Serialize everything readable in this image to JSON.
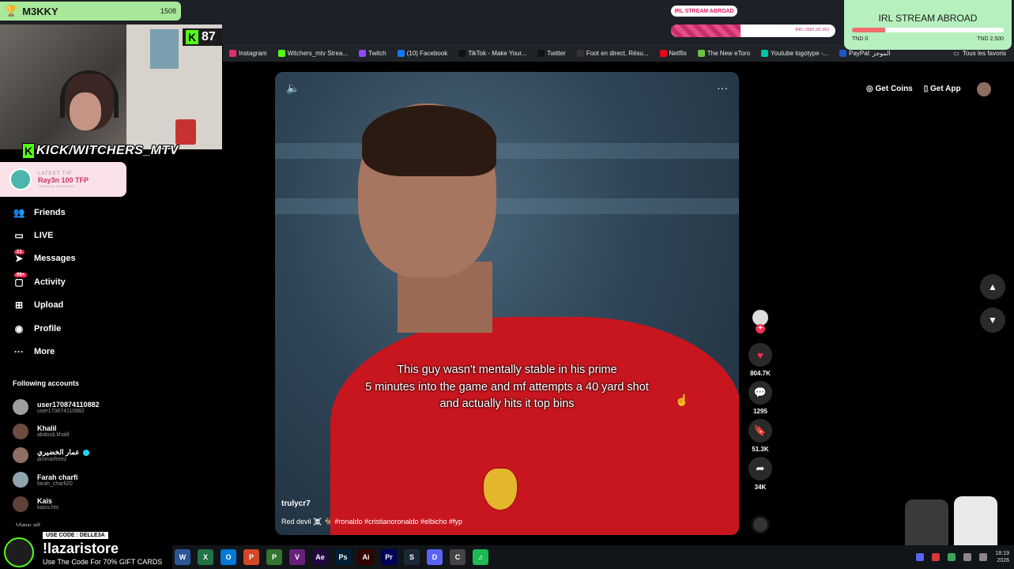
{
  "overlay": {
    "leaderboard": {
      "name": "M3KKY",
      "score": "1508"
    },
    "kick_viewers": {
      "badge": "K",
      "count": "87"
    },
    "kick_banner": {
      "badge": "K",
      "text": "KICK/WITCHERS_MTV"
    },
    "latest_tip": {
      "label": "LATEST TIP",
      "text": "Ray3n 100 TFP",
      "powered": "Powered by Tipeeestream"
    },
    "stream_pill": "IRL STREAM ABROAD",
    "progress": {
      "text": "846 / 2000 (42.3%)",
      "fraction": 0.423
    },
    "goal": {
      "title": "IRL STREAM ABROAD",
      "low": "TND 0",
      "high": "TND 2,500",
      "fraction": 0.22
    },
    "promo": {
      "code": "USE CODE : DELLE3A",
      "title": "!lazaristore",
      "subtitle": "Use The Code For 70% GIFT CARDS"
    }
  },
  "bookmarks": [
    {
      "label": "Instagram",
      "color": "#e1306c"
    },
    {
      "label": "Witchers_mtv Strea...",
      "color": "#53fc18"
    },
    {
      "label": "Twitch",
      "color": "#9146ff"
    },
    {
      "label": "(10) Facebook",
      "color": "#1877f2"
    },
    {
      "label": "TikTok - Make Your...",
      "color": "#111111"
    },
    {
      "label": "Twitter",
      "color": "#111111"
    },
    {
      "label": "Foot en direct, Résu...",
      "color": "#333333"
    },
    {
      "label": "Netflix",
      "color": "#e50914"
    },
    {
      "label": "The New eToro",
      "color": "#69c53e"
    },
    {
      "label": "Youtube logotype -...",
      "color": "#00c4a7"
    },
    {
      "label": "PayPal: الموجز",
      "color": "#1a56c4"
    }
  ],
  "bookmarks_all": "Tous les favoris",
  "nav": [
    {
      "label": "Friends",
      "icon": "👥",
      "badge": ""
    },
    {
      "label": "LIVE",
      "icon": "▭",
      "badge": ""
    },
    {
      "label": "Messages",
      "icon": "➤",
      "badge": "21"
    },
    {
      "label": "Activity",
      "icon": "▢",
      "badge": "99+"
    },
    {
      "label": "Upload",
      "icon": "⊞",
      "badge": ""
    },
    {
      "label": "Profile",
      "icon": "◉",
      "badge": ""
    },
    {
      "label": "More",
      "icon": "···",
      "badge": ""
    }
  ],
  "following_title": "Following accounts",
  "following": [
    {
      "name": "user170874110882",
      "handle": "user170874110882",
      "verified": false
    },
    {
      "name": "Khalil",
      "handle": "abdouli.khalil",
      "verified": false
    },
    {
      "name": "عمار الخضيري",
      "handle": "ammarfreez",
      "verified": true
    },
    {
      "name": "Farah charfi",
      "handle": "farah_charfi20",
      "verified": false
    },
    {
      "name": "Kaïs",
      "handle": "kaiss.hts",
      "verified": false
    }
  ],
  "view_all": "View all",
  "header": {
    "get_coins": "Get Coins",
    "get_app": "Get App"
  },
  "video": {
    "caption_lines": [
      "This guy wasn't mentally stable in his prime",
      "5 minutes into the game and mf attempts a 40 yard shot",
      "and actually hits it top bins"
    ],
    "author": "trulycr7",
    "description": "Red devil ☠️ 🐐 #ronaldo #cristianoronaldo #elbicho #fyp"
  },
  "actions": {
    "likes": "804.7K",
    "comments": "1295",
    "saves": "51.3K",
    "shares": "34K"
  },
  "taskbar": {
    "apps": [
      {
        "label": "W",
        "color": "#2b579a"
      },
      {
        "label": "X",
        "color": "#217346"
      },
      {
        "label": "O",
        "color": "#0078d4"
      },
      {
        "label": "P",
        "color": "#d24726"
      },
      {
        "label": "P",
        "color": "#31752f"
      },
      {
        "label": "V",
        "color": "#68217a"
      },
      {
        "label": "Ae",
        "color": "#1f0740"
      },
      {
        "label": "Ps",
        "color": "#001e36"
      },
      {
        "label": "Ai",
        "color": "#330000"
      },
      {
        "label": "Pr",
        "color": "#00005b"
      },
      {
        "label": "S",
        "color": "#1b2838"
      },
      {
        "label": "D",
        "color": "#5865f2"
      },
      {
        "label": "C",
        "color": "#444444"
      },
      {
        "label": "♫",
        "color": "#1db954"
      }
    ],
    "time": "18:19",
    "date": "2026"
  }
}
